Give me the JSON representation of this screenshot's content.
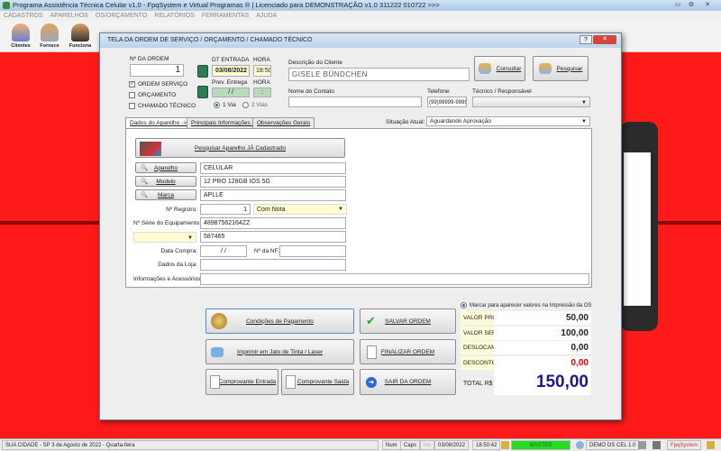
{
  "app": {
    "title": "Programa Assistência Técnica Celular v1.0 - FpqSystem e Virtual Programas ® | Licenciado para  DEMONSTRAÇÃO v1.0 311222 010722 >>>"
  },
  "menu": [
    "CADASTROS",
    "APARELHOS",
    "OS/ORÇAMENTO",
    "RELATÓRIOS",
    "FERRAMENTAS",
    "AJUDA"
  ],
  "toolbar": [
    {
      "label": "Clientes",
      "icon": "clients-icon"
    },
    {
      "label": "Fornece",
      "icon": "supplier-icon"
    },
    {
      "label": "Funciona",
      "icon": "employee-icon"
    }
  ],
  "dialog": {
    "title": "TELA DA ORDEM DE SERVIÇO / ORÇAMENTO / CHAMADO TÉCNICO",
    "order_label": "Nº DA ORDEM",
    "order_number": "1",
    "types": [
      {
        "label": "ORDEM SERVIÇO",
        "checked": true
      },
      {
        "label": "ORÇAMENTO",
        "checked": false
      },
      {
        "label": "CHAMADO TÉCNICO",
        "checked": false
      }
    ],
    "dt_entrada_label": "DT ENTRADA",
    "dt_entrada": "03/08/2022",
    "hora_label": "HORA",
    "hora": "18:50",
    "prev_label": "Prev. Entrega",
    "prev_value": "/ /",
    "hora2_label": "HORA",
    "hora2": ":",
    "via1": "1 Via",
    "via2": "2 Vias",
    "via_selected": "1 Via",
    "cliente_label": "Descrição do Cliente",
    "cliente": "GISELE BÜNDCHEN",
    "consultar": "Consultar",
    "pesquisar": "Pesquisar",
    "contato_label": "Nome do Contato",
    "contato": "",
    "telefone_label": "Telefone",
    "telefone": "(99)99999-9999",
    "tecnico_label": "Técnico / Responsável",
    "tecnico": "",
    "tabs": [
      "Dados do Aparelho ->",
      "Principais Informações ->",
      "Observações Gerais"
    ],
    "situacao_label": "Situação Atual:",
    "situacao": "Aguardando Aprovação",
    "device": {
      "search_btn": "Pesquisar Aparelho JÁ Cadastrado",
      "aparelho_btn": "Aparelho",
      "aparelho": "CELULAR",
      "modelo_btn": "Modelo",
      "modelo": "12 PRO 128GB IOS 5G",
      "marca_btn": "Marca",
      "marca": "APLLE",
      "registro_label": "Nº Registro:",
      "registro": "1",
      "nota": "Com Nota",
      "serie_label": "Nº Série do Equipamento:",
      "serie": "48987562164ZZ",
      "extra_select": "",
      "extra_value": "587465",
      "compra_label": "Data Compra:",
      "compra": "/ /",
      "nf_label": "Nº da NF:",
      "nf": "",
      "loja_label": "Dados da Loja:",
      "loja": "",
      "info_label": "Informações e Acessórios:",
      "info": ""
    },
    "actions": {
      "pagamento": "Condições de Pagamento",
      "imprimir": "Imprimir em Jato de Tinta / Laser",
      "entrada": "Comprovante Entrada",
      "saida": "Comprovante Saida",
      "salvar": "SALVAR ORDEM",
      "finalizar": "FINALIZAR ORDEM",
      "sair": "SAIR DA ORDEM"
    },
    "summary": {
      "marcar": "Marcar para aparecer valores na Impressão da OS",
      "rows": [
        {
          "label": "VALOR PRODUTOS",
          "value": "50,00"
        },
        {
          "label": "VALOR SERVICOS",
          "value": "100,00"
        },
        {
          "label": "DESLOCAMENTO",
          "value": "0,00"
        },
        {
          "label": "DESCONTO",
          "value": "0,00"
        }
      ],
      "total_label": "TOTAL R$",
      "total": "150,00"
    }
  },
  "status": {
    "city": "SUA CIDADE - SP  3 de Agosto de 2022 - Quarta-feira",
    "num": "Num",
    "caps": "Caps",
    "ins": "Ins",
    "date": "03/08/2022",
    "time": "18:50:42",
    "user": "MASTER",
    "version": "DEMO OS CEL 1.0",
    "brand": "FpqSystem"
  },
  "colors": {
    "background": "#ff1a1a",
    "desconto": "#e00000",
    "total": "#1a1a8c",
    "master": "#22dd22"
  }
}
